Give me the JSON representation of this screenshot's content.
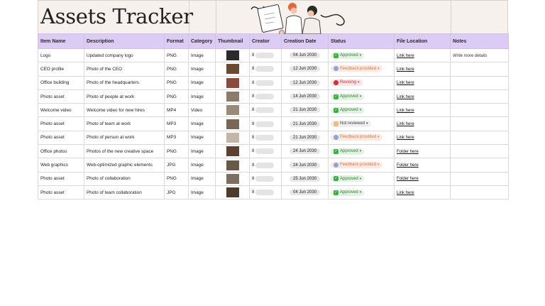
{
  "title": "Assets Tracker",
  "columns": [
    "Item Name",
    "Description",
    "Format",
    "Category",
    "Thumbnail",
    "Creator",
    "Creation Date",
    "Status",
    "File Location",
    "Notes"
  ],
  "rows": [
    {
      "name": "Logo",
      "description": "Updated company logo",
      "format": "PNG",
      "category": "Image",
      "thumb_color": "#2b2b2b",
      "creator": "8",
      "date": "04 Jun 2030",
      "status": "Approved",
      "status_kind": "approved",
      "location": "Link here",
      "notes": "Write more details"
    },
    {
      "name": "CEO profile",
      "description": "Photo of the CEO",
      "format": "PNG",
      "category": "Image",
      "thumb_color": "#6b4a2f",
      "creator": "8",
      "date": "12 Jun 2030",
      "status": "Feedback provided",
      "status_kind": "feedback",
      "location": "Link here",
      "notes": ""
    },
    {
      "name": "Office building",
      "description": "Photo of the headquarters",
      "format": "PNG",
      "category": "Image",
      "thumb_color": "#8c4a3a",
      "creator": "8",
      "date": "12 Jun 2030",
      "status": "Revising",
      "status_kind": "revising",
      "location": "Link here",
      "notes": ""
    },
    {
      "name": "Photo asset",
      "description": "Photo of people at work",
      "format": "PNG",
      "category": "Image",
      "thumb_color": "#8a7b6a",
      "creator": "8",
      "date": "14 Jun 2030",
      "status": "Approved",
      "status_kind": "approved",
      "location": "Link here",
      "notes": ""
    },
    {
      "name": "Welcome video",
      "description": "Welcome video for new hires",
      "format": "MP4",
      "category": "Video",
      "thumb_color": "#9a8a78",
      "creator": "8",
      "date": "21 Jun 2030",
      "status": "Approved",
      "status_kind": "approved",
      "location": "Link here",
      "notes": ""
    },
    {
      "name": "Photo asset",
      "description": "Photo of team at work",
      "format": "MP3",
      "category": "Image",
      "thumb_color": "#7a6656",
      "creator": "8",
      "date": "21 Jun 2030",
      "status": "Not reviewed",
      "status_kind": "notreviewed",
      "location": "Link here",
      "notes": ""
    },
    {
      "name": "Photo asset",
      "description": "Photo of person at work",
      "format": "MP3",
      "category": "Image",
      "thumb_color": "#c4b5a5",
      "creator": "8",
      "date": "21 Jun 2030",
      "status": "Feedback provided",
      "status_kind": "feedback",
      "location": "Link here",
      "notes": ""
    },
    {
      "name": "Office photos",
      "description": "Photos of the new creative space",
      "format": "PNG",
      "category": "Image",
      "thumb_color": "#5e4030",
      "creator": "8",
      "date": "24 Jun 2030",
      "status": "Approved",
      "status_kind": "approved",
      "location": "Folder here",
      "notes": ""
    },
    {
      "name": "Web graphics",
      "description": "Web-optimized graphic elements",
      "format": "JPG",
      "category": "Image",
      "thumb_color": "#6a5848",
      "creator": "8",
      "date": "24 Jun 2030",
      "status": "Feedback provided",
      "status_kind": "feedback",
      "location": "Folder here",
      "notes": ""
    },
    {
      "name": "Photo asset",
      "description": "Photo of collaboration",
      "format": "PNG",
      "category": "Image",
      "thumb_color": "#7d6e60",
      "creator": "8",
      "date": "25 Jun 2030",
      "status": "Approved",
      "status_kind": "approved",
      "location": "Folder here",
      "notes": ""
    },
    {
      "name": "Photo asset",
      "description": "Photo of team collaboration",
      "format": "JPG",
      "category": "Image",
      "thumb_color": "#4e3b2c",
      "creator": "8",
      "date": "04 Jun 2030",
      "status": "Approved",
      "status_kind": "approved",
      "location": "Link here",
      "notes": ""
    }
  ],
  "colors": {
    "header_bg": "#dccbf4",
    "banner_bg": "#f6f1ec"
  }
}
